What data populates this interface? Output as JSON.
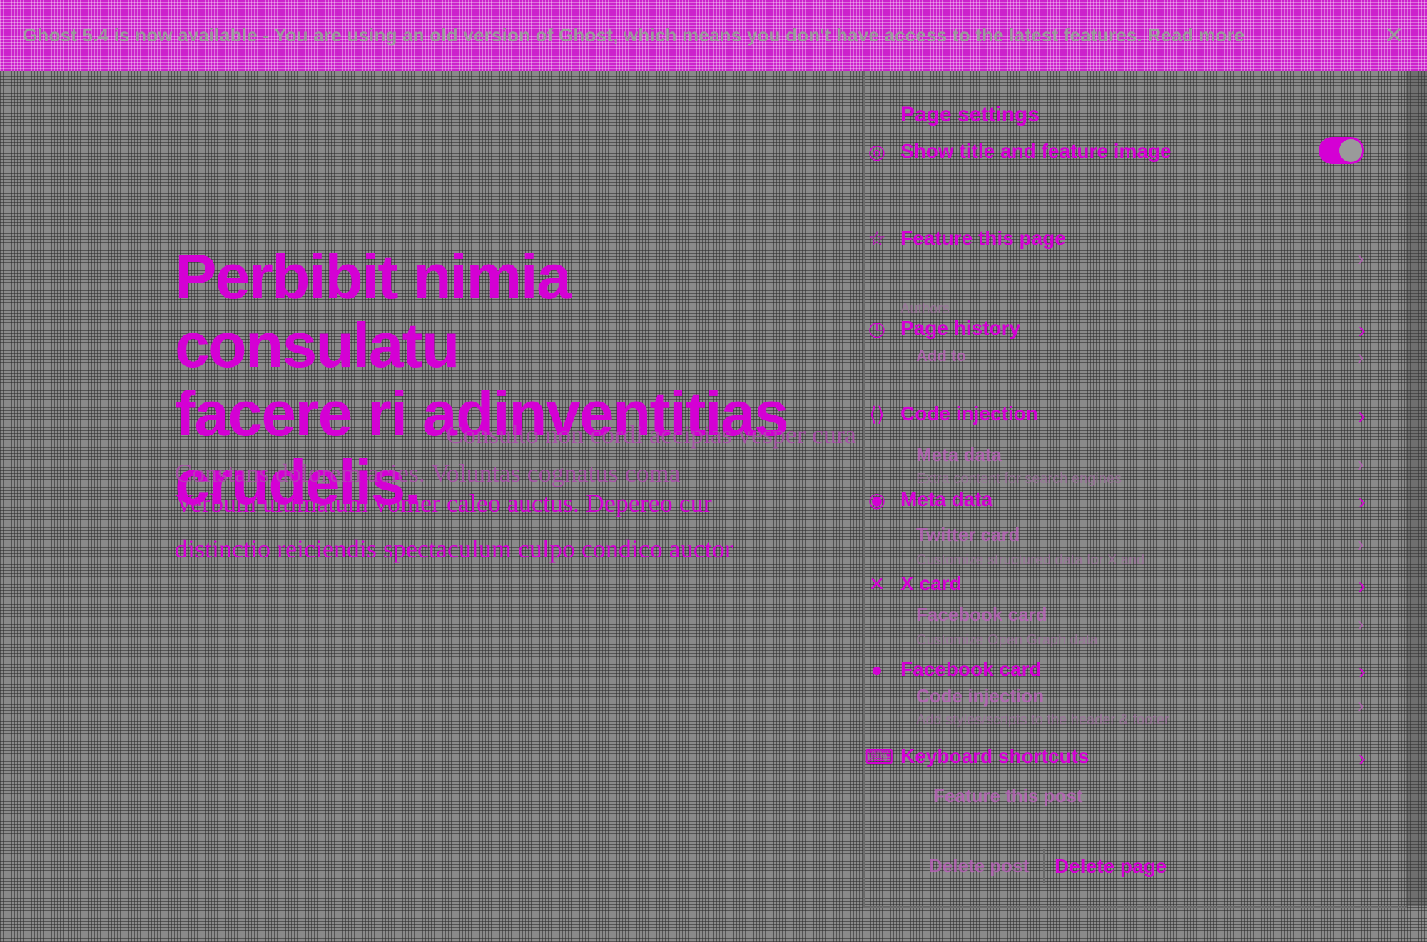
{
  "banner": {
    "text": "Ghost 5.4 is now available - You are using an old version of Ghost, which means you don't have access to the latest features. Read more",
    "link_label": "Read more",
    "close_icon": "close-icon"
  },
  "editor": {
    "title_dark": "Aenean in ornare pellentesque",
    "title_pink_line1": "Perbibit nimia consulatu",
    "title_pink_line2": "facere ri adinventitias",
    "title_pink_line3": "crudelis.",
    "body_line1": "Consulto non cordi accipias vesper cura sufficit",
    "body_line2": "Constans dolorem acies. Voluntas cognatus coma",
    "body_line3": "Verbum ultimatum vomer caleo auctus. Depereo cur",
    "body_line4": "distinctio reiciendis spectaculum culpo condico auctor"
  },
  "panel": {
    "title": "Page settings",
    "toggle_label": "Show title and feature image",
    "toggle_on": true,
    "items": [
      {
        "icon": "star-icon",
        "label": "Feature this page"
      },
      {
        "icon": "history-icon",
        "label": "Page history"
      },
      {
        "icon": "code-icon",
        "label": "Code injection"
      },
      {
        "icon": "meta-icon",
        "label": "Meta data"
      },
      {
        "icon": "x-icon",
        "label": "X card"
      },
      {
        "icon": "facebook-icon",
        "label": "Facebook card"
      },
      {
        "icon": "keyboard-icon",
        "label": "Keyboard shortcuts"
      }
    ],
    "ghost": {
      "authors": "Authors",
      "history": "Add to",
      "meta_data": "Meta data",
      "meta_sub": "Extra content for search engines",
      "twitter": "Twitter card",
      "twitter_sub": "Customize structured data for X and",
      "facebook": "Facebook card",
      "facebook_sub": "Customize Open Graph data",
      "code": "Code injection",
      "code_sub": "Add styles/scripts to the header & footer",
      "feature": "Feature this post",
      "delete": "Delete post"
    },
    "delete_label": "Delete page"
  },
  "colors": {
    "accent": "#d400d4",
    "background": "#8a8a8a"
  }
}
